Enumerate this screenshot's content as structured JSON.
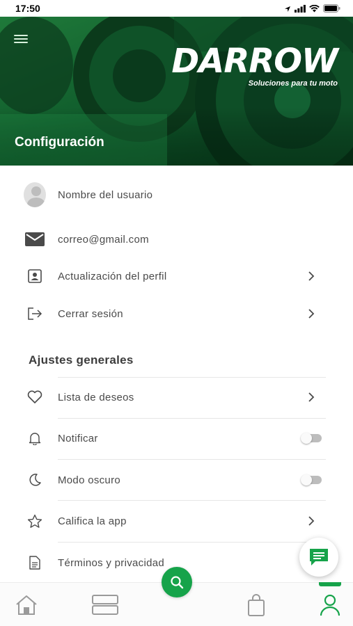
{
  "status_bar": {
    "time": "17:50"
  },
  "header": {
    "brand_name": "DARROW",
    "brand_tagline": "Soluciones para tu moto",
    "title": "Configuración"
  },
  "profile": {
    "username": "Nombre del usuario",
    "email": "correo@gmail.com",
    "update_profile": "Actualización del perfil",
    "logout": "Cerrar sesión"
  },
  "general": {
    "section_title": "Ajustes generales",
    "wishlist": "Lista de deseos",
    "notify": "Notificar",
    "notify_enabled": false,
    "dark_mode": "Modo oscuro",
    "dark_mode_enabled": false,
    "rate_app": "Califica la app",
    "terms": "Términos y privacidad"
  },
  "bottom_nav": {
    "items": [
      "home-icon",
      "catalog-icon",
      "search-icon",
      "bag-icon",
      "profile-icon"
    ],
    "active": "profile-icon"
  },
  "colors": {
    "accent": "#16a34a",
    "header_bg": "#0d4e27"
  }
}
